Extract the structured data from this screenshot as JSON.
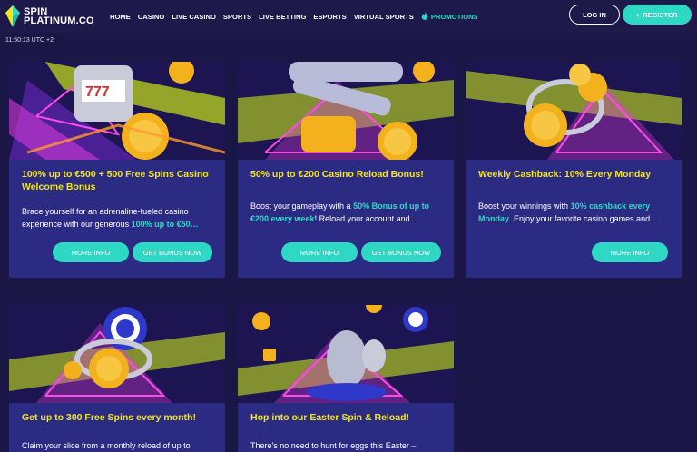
{
  "header": {
    "logo_line1": "SPIN",
    "logo_line2": "PLATINUM.CO",
    "nav": [
      "HOME",
      "CASINO",
      "LIVE CASINO",
      "SPORTS",
      "LIVE BETTING",
      "ESPORTS",
      "VIRTUAL SPORTS"
    ],
    "promotions_label": "PROMOTIONS",
    "login_label": "LOG IN",
    "register_label": "REGISTER"
  },
  "clock": "11:50:13 UTC +2",
  "colors": {
    "accent": "#2fd8c4",
    "title": "#f2e51a",
    "card": "#2c2b84",
    "bg": "#1a1746"
  },
  "cards": [
    {
      "title": "100% up to €500 + 500 Free Spins Casino Welcome Bonus",
      "desc_pre": "Brace yourself for an adrenaline-fueled casino experience with our generous ",
      "desc_hl": "100% up to €50…",
      "desc_post": "",
      "more_info": "MORE INFO",
      "get_bonus": "GET BONUS NOW",
      "image": "slot-machine-and-coins"
    },
    {
      "title": "50% up to €200 Casino Reload Bonus!",
      "desc_pre": "Boost your gameplay with a ",
      "desc_hl": "50% Bonus of up to €200 every week",
      "desc_post": "! Reload your account and…",
      "more_info": "MORE INFO",
      "get_bonus": "GET BONUS NOW",
      "image": "slot-reels-and-coin"
    },
    {
      "title": "Weekly Cashback: 10% Every Monday",
      "desc_pre": "Boost your winnings with ",
      "desc_hl": "10% cashback every Monday",
      "desc_post": ". Enjoy your favorite casino games and…",
      "more_info": "MORE INFO",
      "image": "coin-stack-cashback"
    },
    {
      "title": "Get up to 300 Free Spins every month!",
      "desc_pre": "Claim your slice from a monthly reload of up to",
      "desc_hl": "",
      "desc_post": "",
      "image": "poker-chip-and-coins"
    },
    {
      "title": "Hop into our Easter Spin & Reload!",
      "desc_pre": "There's no need to hunt for eggs this Easter –",
      "desc_hl": "",
      "desc_post": "",
      "image": "easter-eggs-and-chips"
    }
  ]
}
